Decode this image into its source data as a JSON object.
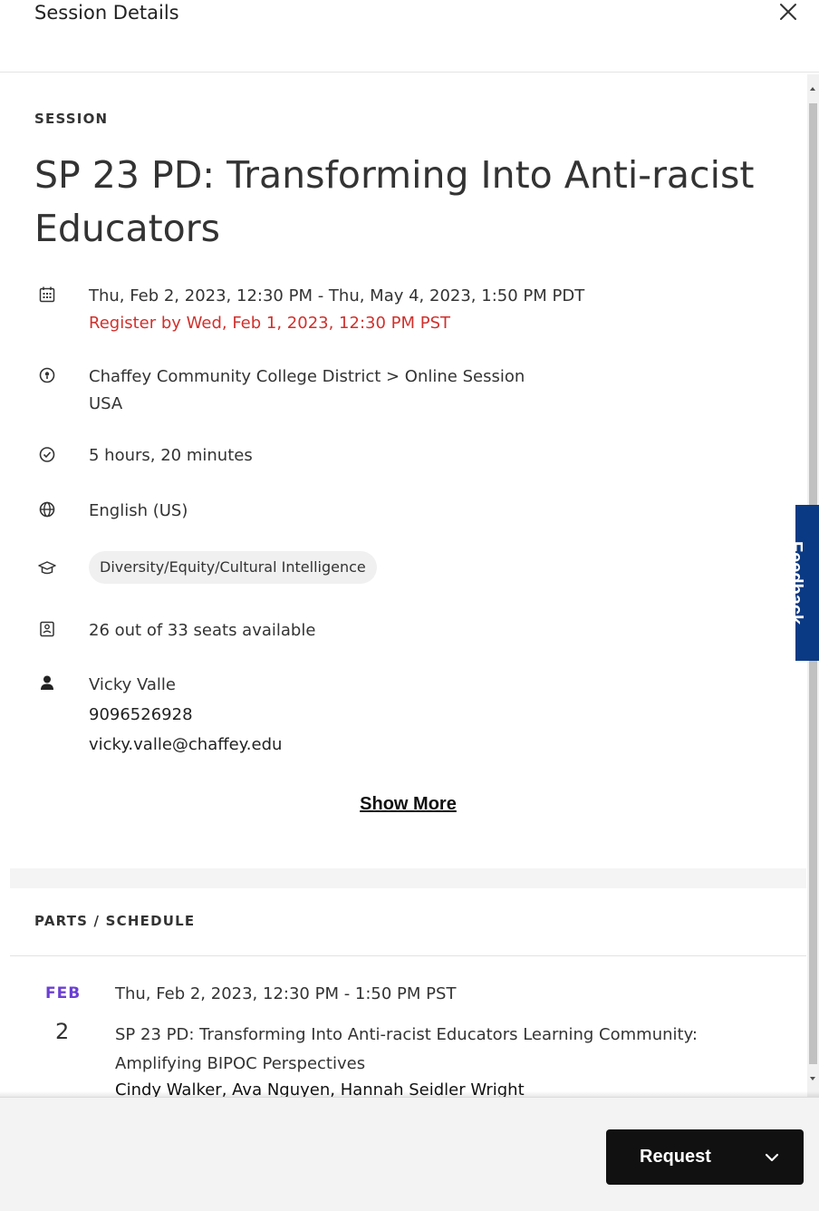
{
  "header": {
    "title": "Session Details"
  },
  "session": {
    "eyebrow": "SESSION",
    "title": "SP 23 PD: Transforming Into Anti-racist Educators",
    "datetime": "Thu, Feb 2, 2023, 12:30 PM - Thu, May 4, 2023, 1:50 PM PDT",
    "register_by": "Register by Wed, Feb 1, 2023, 12:30 PM PST",
    "location_line1": "Chaffey Community College District > Online Session",
    "location_line2": "USA",
    "duration": "5 hours, 20 minutes",
    "language": "English (US)",
    "tag": "Diversity/Equity/Cultural Intelligence",
    "seats": "26 out of 33 seats available",
    "contact_name": "Vicky Valle",
    "contact_phone": "9096526928",
    "contact_email": "vicky.valle@chaffey.edu",
    "show_more": "Show More"
  },
  "parts": {
    "heading": "PARTS / SCHEDULE",
    "items": [
      {
        "month": "FEB",
        "day": "2",
        "time": "Thu, Feb 2, 2023, 12:30 PM - 1:50 PM PST",
        "title": "SP 23 PD: Transforming Into Anti-racist Educators Learning Community: Amplifying BIPOC Perspectives",
        "people": "Cindy Walker, Ava Nguyen, Hannah Seidler Wright"
      }
    ]
  },
  "feedback": {
    "label": "Feedback"
  },
  "footer": {
    "request_label": "Request"
  },
  "icons": {
    "close": "close-icon",
    "calendar": "calendar-icon",
    "location": "location-pin-icon",
    "clock": "clock-icon",
    "globe": "globe-icon",
    "category": "graduation-cap-icon",
    "seats": "seat-icon",
    "contact": "person-icon",
    "dropdown": "chevron-down-icon"
  },
  "colors": {
    "warning": "#d0312d",
    "month_accent": "#6b3fd3",
    "feedback_bg": "#0b3a84",
    "button_bg": "#111111"
  }
}
